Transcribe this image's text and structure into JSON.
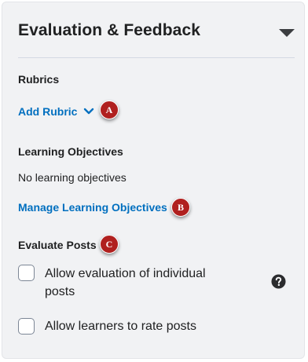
{
  "panel": {
    "title": "Evaluation & Feedback",
    "collapse_icon": "caret-down-icon"
  },
  "rubrics": {
    "title": "Rubrics",
    "add_link": "Add Rubric",
    "dropdown_icon": "chevron-down-icon",
    "marker": "A"
  },
  "learning_objectives": {
    "title": "Learning Objectives",
    "empty_text": "No learning objectives",
    "manage_link": "Manage Learning Objectives",
    "marker": "B"
  },
  "evaluate_posts": {
    "title": "Evaluate Posts",
    "marker": "C",
    "options": [
      {
        "label_line1": "Allow evaluation of individual",
        "label_line2": "posts",
        "checked": false
      },
      {
        "label_line1": "Allow learners to rate posts",
        "checked": false
      }
    ],
    "help_icon": "question-circle-icon"
  },
  "colors": {
    "link": "#006fbf",
    "marker": "#b0201f",
    "panel_bg": "#f1f2f4"
  }
}
